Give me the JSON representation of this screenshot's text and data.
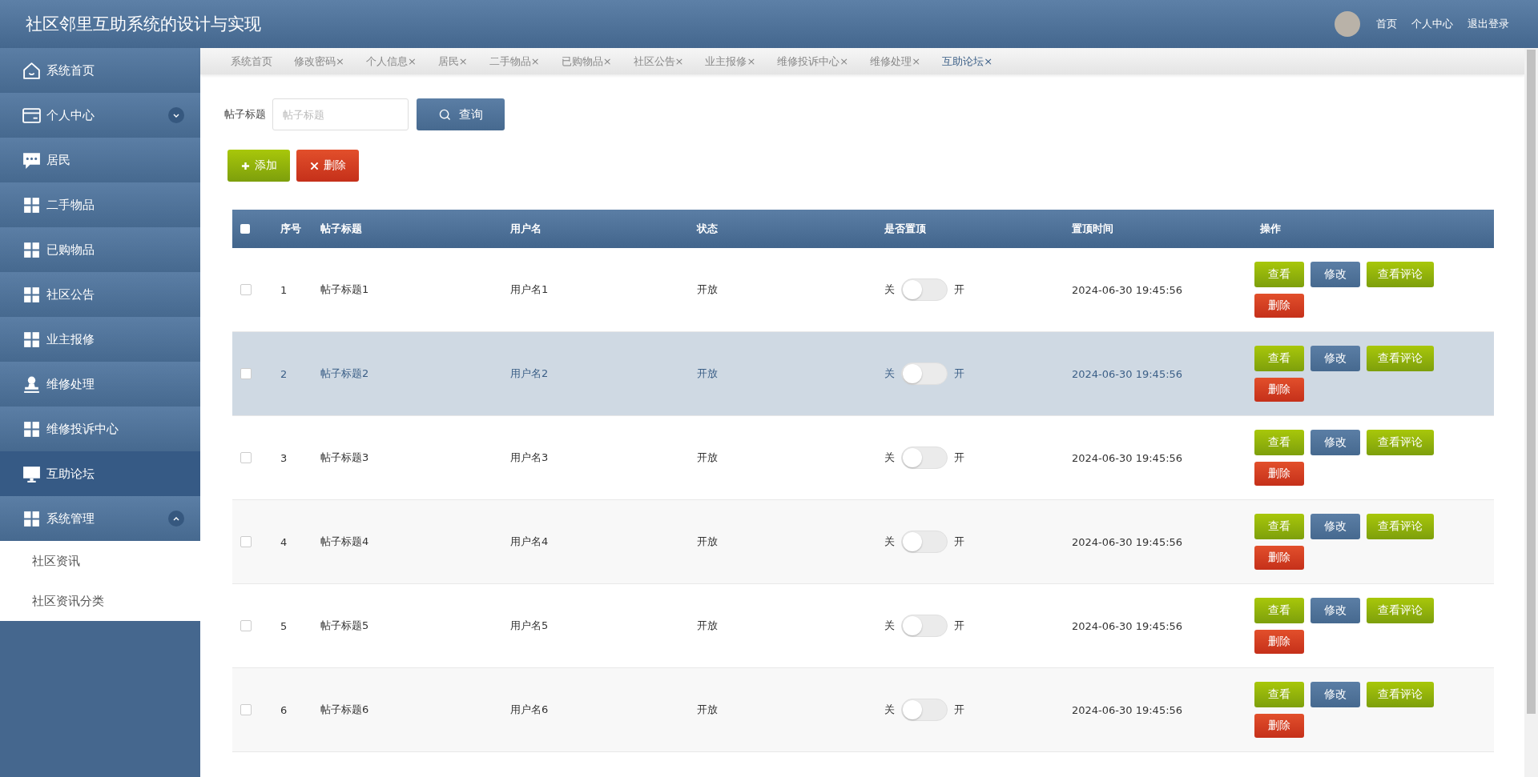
{
  "header": {
    "title": "社区邻里互助系统的设计与实现",
    "links": [
      "首页",
      "个人中心",
      "退出登录"
    ]
  },
  "sidebar": {
    "items": [
      {
        "label": "系统首页",
        "kind": "home",
        "selected": false
      },
      {
        "label": "个人中心",
        "kind": "card",
        "selected": false,
        "expanded": false
      },
      {
        "label": "居民",
        "kind": "chat",
        "selected": false
      },
      {
        "label": "二手物品",
        "kind": "grid",
        "selected": false
      },
      {
        "label": "已购物品",
        "kind": "grid",
        "selected": false
      },
      {
        "label": "社区公告",
        "kind": "grid",
        "selected": false
      },
      {
        "label": "业主报修",
        "kind": "grid",
        "selected": false
      },
      {
        "label": "维修处理",
        "kind": "person",
        "selected": false
      },
      {
        "label": "维修投诉中心",
        "kind": "grid",
        "selected": false
      },
      {
        "label": "互助论坛",
        "kind": "monitor",
        "selected": true
      },
      {
        "label": "系统管理",
        "kind": "grid",
        "selected": false,
        "expanded": true,
        "children": [
          {
            "label": "社区资讯"
          },
          {
            "label": "社区资讯分类"
          }
        ]
      }
    ]
  },
  "tabs": [
    {
      "label": "系统首页",
      "closable": false,
      "selected": false
    },
    {
      "label": "修改密码",
      "closable": true,
      "selected": false
    },
    {
      "label": "个人信息",
      "closable": true,
      "selected": false
    },
    {
      "label": "居民",
      "closable": true,
      "selected": false
    },
    {
      "label": "二手物品",
      "closable": true,
      "selected": false
    },
    {
      "label": "已购物品",
      "closable": true,
      "selected": false
    },
    {
      "label": "社区公告",
      "closable": true,
      "selected": false
    },
    {
      "label": "业主报修",
      "closable": true,
      "selected": false
    },
    {
      "label": "维修投诉中心",
      "closable": true,
      "selected": false
    },
    {
      "label": "维修处理",
      "closable": true,
      "selected": false
    },
    {
      "label": "互助论坛",
      "closable": true,
      "selected": true
    }
  ],
  "close_mark": "×",
  "search": {
    "label": "帖子标题",
    "placeholder": "帖子标题",
    "button": "查询"
  },
  "toolbar": [
    {
      "label": "添加",
      "kind": "add"
    },
    {
      "label": "删除",
      "kind": "delete"
    }
  ],
  "table": {
    "all_checked": false,
    "columns": [
      "序号",
      "帖子标题",
      "用户名",
      "状态",
      "是否置顶",
      "置顶时间",
      "操作"
    ],
    "rows": [
      {
        "no": "1",
        "title": "帖子标题1",
        "user": "用户名1",
        "status": "开放",
        "off": "关",
        "on": "开",
        "pinned": false,
        "time": "2024-06-30 19:45:56",
        "selected": false,
        "checked": false,
        "actions": [
          {
            "label": "查看",
            "kind": "view"
          },
          {
            "label": "修改",
            "kind": "edit"
          },
          {
            "label": "查看评论",
            "kind": "view"
          },
          {
            "label": "删除",
            "kind": "delete"
          }
        ]
      },
      {
        "no": "2",
        "title": "帖子标题2",
        "user": "用户名2",
        "status": "开放",
        "off": "关",
        "on": "开",
        "pinned": false,
        "time": "2024-06-30 19:45:56",
        "selected": true,
        "checked": false,
        "actions": [
          {
            "label": "查看",
            "kind": "view"
          },
          {
            "label": "修改",
            "kind": "edit"
          },
          {
            "label": "查看评论",
            "kind": "view"
          },
          {
            "label": "删除",
            "kind": "delete"
          }
        ]
      },
      {
        "no": "3",
        "title": "帖子标题3",
        "user": "用户名3",
        "status": "开放",
        "off": "关",
        "on": "开",
        "pinned": false,
        "time": "2024-06-30 19:45:56",
        "selected": false,
        "checked": false,
        "actions": [
          {
            "label": "查看",
            "kind": "view"
          },
          {
            "label": "修改",
            "kind": "edit"
          },
          {
            "label": "查看评论",
            "kind": "view"
          },
          {
            "label": "删除",
            "kind": "delete"
          }
        ]
      },
      {
        "no": "4",
        "title": "帖子标题4",
        "user": "用户名4",
        "status": "开放",
        "off": "关",
        "on": "开",
        "pinned": false,
        "time": "2024-06-30 19:45:56",
        "selected": false,
        "checked": false,
        "actions": [
          {
            "label": "查看",
            "kind": "view"
          },
          {
            "label": "修改",
            "kind": "edit"
          },
          {
            "label": "查看评论",
            "kind": "view"
          },
          {
            "label": "删除",
            "kind": "delete"
          }
        ]
      },
      {
        "no": "5",
        "title": "帖子标题5",
        "user": "用户名5",
        "status": "开放",
        "off": "关",
        "on": "开",
        "pinned": false,
        "time": "2024-06-30 19:45:56",
        "selected": false,
        "checked": false,
        "actions": [
          {
            "label": "查看",
            "kind": "view"
          },
          {
            "label": "修改",
            "kind": "edit"
          },
          {
            "label": "查看评论",
            "kind": "view"
          },
          {
            "label": "删除",
            "kind": "delete"
          }
        ]
      },
      {
        "no": "6",
        "title": "帖子标题6",
        "user": "用户名6",
        "status": "开放",
        "off": "关",
        "on": "开",
        "pinned": false,
        "time": "2024-06-30 19:45:56",
        "selected": false,
        "checked": false,
        "actions": [
          {
            "label": "查看",
            "kind": "view"
          },
          {
            "label": "修改",
            "kind": "edit"
          },
          {
            "label": "查看评论",
            "kind": "view"
          },
          {
            "label": "删除",
            "kind": "delete"
          }
        ]
      }
    ]
  }
}
